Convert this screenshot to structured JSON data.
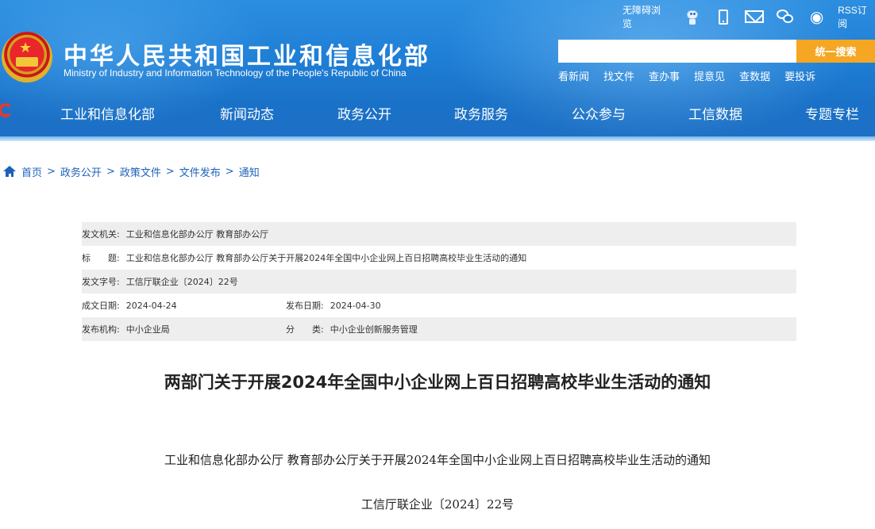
{
  "header": {
    "site_title": "中华人民共和国工业和信息化部",
    "site_subtitle": "Ministry of Industry and Information Technology of the People's Republic of China",
    "top_links": {
      "accessibility": "无障碍浏览",
      "rss": "RSS订阅"
    },
    "icons": [
      "robot-icon",
      "mobile-icon",
      "mail-icon",
      "wechat-icon",
      "weibo-icon"
    ],
    "search": {
      "placeholder": "",
      "button": "统一搜索"
    },
    "quick_links": [
      "看新闻",
      "找文件",
      "查办事",
      "提意见",
      "查数据",
      "要投诉"
    ],
    "nav": [
      "工业和信息化部",
      "新闻动态",
      "政务公开",
      "政务服务",
      "公众参与",
      "工信数据",
      "专题专栏"
    ],
    "colors": {
      "header_blue": "#1f7fd6",
      "search_orange": "#f5a623",
      "link_blue": "#1d62b8"
    }
  },
  "breadcrumb": [
    "首页",
    "政务公开",
    "政策文件",
    "文件发布",
    "通知"
  ],
  "breadcrumb_separator": ">",
  "info": {
    "issuer_label": "发文机关:",
    "issuer": "工业和信息化部办公厅 教育部办公厅",
    "title_label": "标　　题:",
    "title": "工业和信息化部办公厅 教育部办公厅关于开展2024年全国中小企业网上百日招聘高校毕业生活动的通知",
    "docno_label": "发文字号:",
    "docno": "工信厅联企业〔2024〕22号",
    "created_label": "成文日期:",
    "created": "2024-04-24",
    "published_label": "发布日期:",
    "published": "2024-04-30",
    "org_label": "发布机构:",
    "org": "中小企业局",
    "category_label": "分　　类:",
    "category": "中小企业创新服务管理"
  },
  "article": {
    "title": "两部门关于开展2024年全国中小企业网上百日招聘高校毕业生活动的通知",
    "subtitle": "工业和信息化部办公厅 教育部办公厅关于开展2024年全国中小企业网上百日招聘高校毕业生活动的通知",
    "docno": "工信厅联企业〔2024〕22号"
  }
}
